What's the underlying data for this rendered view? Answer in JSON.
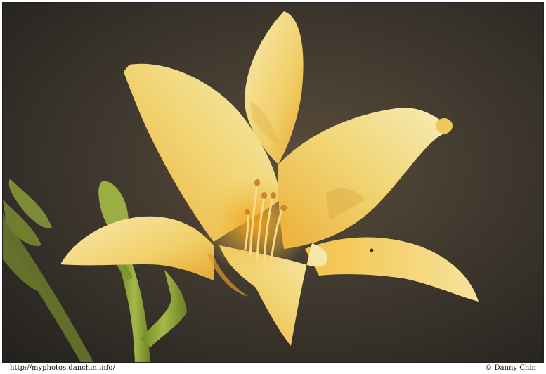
{
  "photo": {
    "subject": "yellow-daylily-icon"
  },
  "footer": {
    "url": "http://myphotos.danchin.info/",
    "credit": "© Danny Chin"
  },
  "colors": {
    "background_dark": "#2a2622",
    "petal_light": "#f5e6a0",
    "petal_mid": "#f0cc5a",
    "petal_deep": "#e8a52a",
    "stem_green": "#8aa33a",
    "frame": "#ffffff"
  }
}
